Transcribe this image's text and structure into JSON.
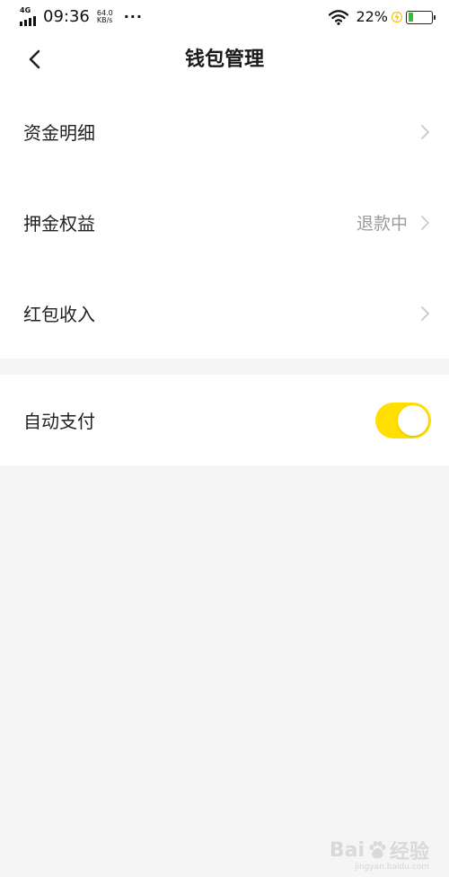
{
  "status_bar": {
    "network": "4G",
    "time": "09:36",
    "speed_value": "64.0",
    "speed_unit": "KB/s",
    "more": "···",
    "battery_percent": "22%",
    "battery_level": 0.22,
    "charging": true,
    "battery_color": "#2fc42f",
    "bolt_color": "#f1c40f"
  },
  "header": {
    "back_icon": "chevron-left-icon",
    "title": "钱包管理"
  },
  "menu": {
    "items": [
      {
        "label": "资金明细",
        "value": ""
      },
      {
        "label": "押金权益",
        "value": "退款中"
      },
      {
        "label": "红包收入",
        "value": ""
      }
    ]
  },
  "settings": {
    "auto_pay_label": "自动支付",
    "auto_pay_enabled": true,
    "toggle_color": "#ffde00"
  },
  "watermark": {
    "brand_left": "Bai",
    "brand_right": "经验",
    "url": "jingyan.baidu.com"
  }
}
